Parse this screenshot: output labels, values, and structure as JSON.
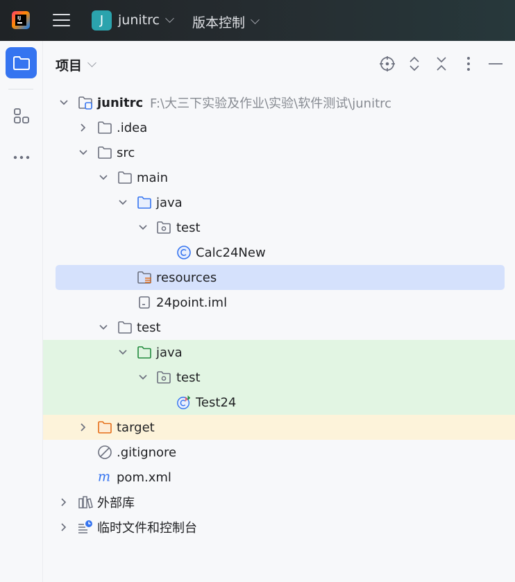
{
  "titlebar": {
    "project_badge": "J",
    "project_name": "junitrc",
    "vcs_label": "版本控制"
  },
  "panel": {
    "title": "项目"
  },
  "colors": {
    "selection": "#d5e1fc",
    "test_sources_bg": "#e2f5e3",
    "excluded_bg": "#fdf3da",
    "accent": "#3574f0"
  },
  "tree": [
    {
      "label": "junitrc",
      "path": "F:\\大三下实验及作业\\实验\\软件测试\\junitrc",
      "icon": "module-folder-icon",
      "expanded": true
    },
    {
      "label": ".idea",
      "icon": "folder-icon",
      "expanded": false
    },
    {
      "label": "src",
      "icon": "folder-icon",
      "expanded": true
    },
    {
      "label": "main",
      "icon": "folder-icon",
      "expanded": true
    },
    {
      "label": "java",
      "icon": "source-root-folder-icon",
      "expanded": true
    },
    {
      "label": "test",
      "icon": "package-icon",
      "expanded": true
    },
    {
      "label": "Calc24New",
      "icon": "java-class-icon"
    },
    {
      "label": "resources",
      "icon": "resources-folder-icon",
      "selected": true
    },
    {
      "label": "24point.iml",
      "icon": "iml-file-icon"
    },
    {
      "label": "test",
      "icon": "folder-icon",
      "expanded": true
    },
    {
      "label": "java",
      "icon": "test-root-folder-icon",
      "expanded": true
    },
    {
      "label": "test",
      "icon": "package-icon",
      "expanded": true
    },
    {
      "label": "Test24",
      "icon": "test-class-icon"
    },
    {
      "label": "target",
      "icon": "excluded-folder-icon",
      "expanded": false
    },
    {
      "label": ".gitignore",
      "icon": "ignored-file-icon"
    },
    {
      "label": "pom.xml",
      "icon": "maven-icon"
    },
    {
      "label": "外部库",
      "icon": "library-icon",
      "expanded": false
    },
    {
      "label": "临时文件和控制台",
      "icon": "scratches-icon",
      "expanded": false
    }
  ]
}
